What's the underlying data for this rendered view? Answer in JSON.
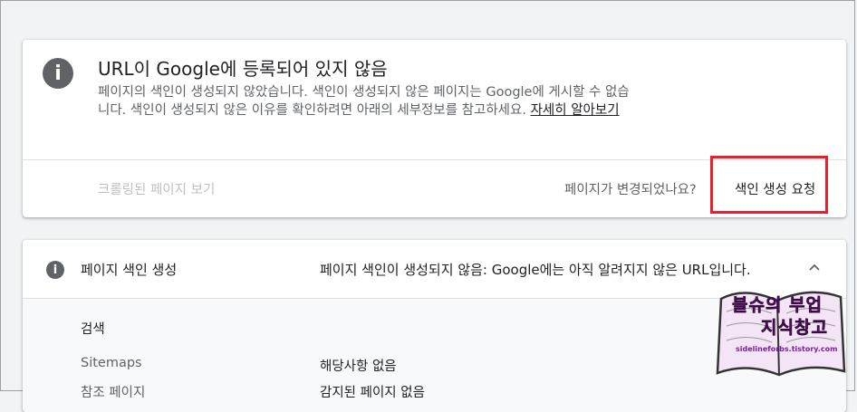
{
  "status_card": {
    "icon": "info-icon",
    "title": "URL이 Google에 등록되어 있지 않음",
    "description": "페이지의 색인이 생성되지 않았습니다. 색인이 생성되지 않은 페이지는 Google에 게시할 수 없습니다. 색인이 생성되지 않은 이유를 확인하려면 아래의 세부정보를 참고하세요.",
    "learn_more": "자세히 알아보기",
    "crawled_page": "크롤링된 페이지 보기",
    "page_changed": "페이지가 변경되었나요?",
    "request_indexing": "색인 생성 요청"
  },
  "coverage": {
    "icon": "info-icon",
    "label": "페이지 색인 생성",
    "status": "페이지 색인이 생성되지 않음: Google에는 아직 알려지지 않은 URL입니다.",
    "section": "검색",
    "rows": [
      {
        "label": "Sitemaps",
        "value": "해당사항 없음"
      },
      {
        "label": "참조 페이지",
        "value": "감지된 페이지 없음"
      }
    ]
  },
  "watermark": {
    "line1": "블슈의 부업",
    "line2": "지식창고",
    "url": "sidelineforbs.tistory.com"
  },
  "colors": {
    "highlight": "#e62129",
    "accent_watermark": "#9c27b0"
  }
}
